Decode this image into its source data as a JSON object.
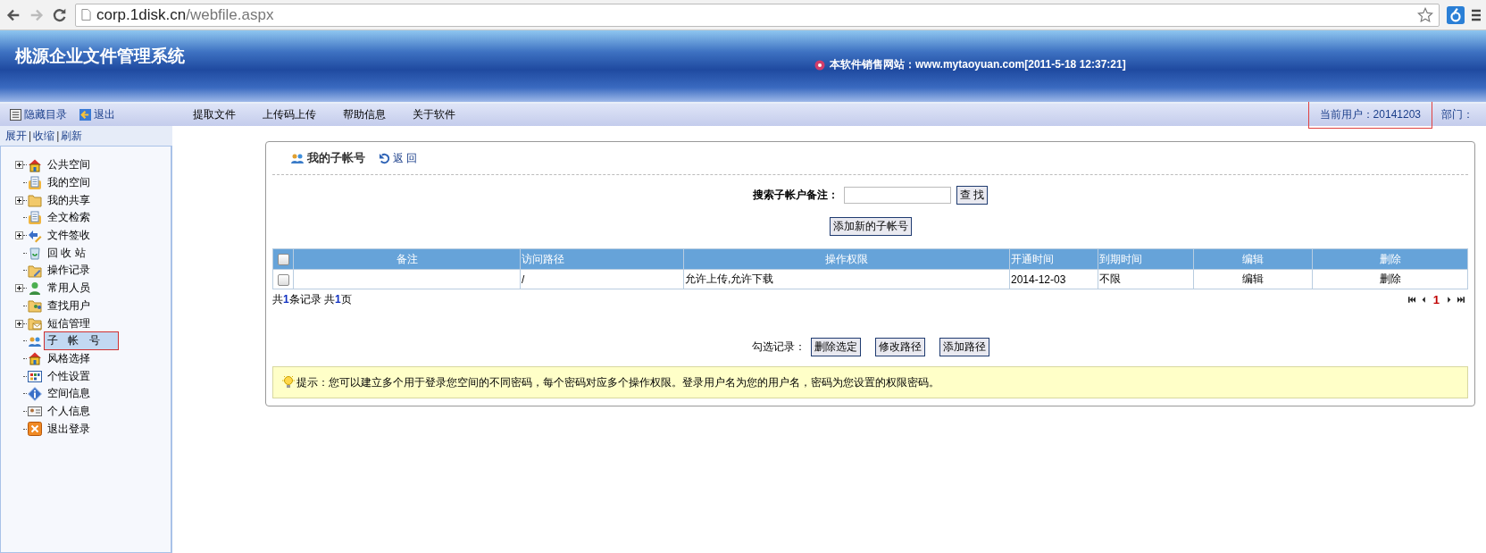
{
  "browser": {
    "url_host": "corp.1disk.cn",
    "url_path": "/webfile.aspx"
  },
  "header": {
    "title": "桃源企业文件管理系统",
    "site_info": "本软件销售网站：www.mytaoyuan.com[2011-5-18 12:37:21]"
  },
  "sidebar_actions": [
    "隐藏目录",
    "退出"
  ],
  "menu": [
    "提取文件",
    "上传码上传",
    "帮助信息",
    "关于软件"
  ],
  "user_info": {
    "current_user": "当前用户：20141203",
    "department": "部门："
  },
  "tree_links": [
    {
      "kind": "link",
      "text": "展开"
    },
    {
      "kind": "separator",
      "text": "|"
    },
    {
      "kind": "link",
      "text": "收缩"
    },
    {
      "kind": "separator",
      "text": "|"
    },
    {
      "kind": "link",
      "text": "刷新"
    }
  ],
  "tree": [
    {
      "label": "公共空间",
      "expanded": false,
      "selected": false
    },
    {
      "label": "我的空间",
      "selected": false
    },
    {
      "label": "我的共享",
      "expanded": false,
      "selected": false
    },
    {
      "label": "全文检索",
      "selected": false
    },
    {
      "label": "文件签收",
      "expanded": false,
      "selected": false
    },
    {
      "label": "回 收 站",
      "selected": false
    },
    {
      "label": "操作记录",
      "selected": false
    },
    {
      "label": "常用人员",
      "expanded": false,
      "selected": false
    },
    {
      "label": "查找用户",
      "selected": false
    },
    {
      "label": "短信管理",
      "expanded": false,
      "selected": false
    },
    {
      "label": "子 帐 号",
      "selected": true
    },
    {
      "label": "风格选择",
      "selected": false
    },
    {
      "label": "个性设置",
      "selected": false
    },
    {
      "label": "空间信息",
      "selected": false
    },
    {
      "label": "个人信息",
      "selected": false
    },
    {
      "label": "退出登录",
      "selected": false
    }
  ],
  "panel": {
    "title": "我的子帐号",
    "back": "返 回",
    "search_label": "搜索子帐户备注：",
    "search_button": "查 找",
    "add_button": "添加新的子帐号",
    "table": {
      "select_all_checked": false,
      "columns": [
        "备注",
        "访问路径",
        "操作权限",
        "开通时间",
        "到期时间",
        "编辑",
        "删除"
      ],
      "rows": [
        {
          "checked": false,
          "cells": [
            "",
            "/",
            "允许上传,允许下载",
            "2014-12-03",
            "不限",
            "编辑",
            "删除"
          ]
        }
      ]
    },
    "summary": "共**1**条记录 共**1**页",
    "current_page": "1",
    "bulk_label": "勾选记录：",
    "bulk_buttons": [
      "删除选定",
      "修改路径",
      "添加路径"
    ],
    "tip": "提示：您可以建立多个用于登录您空间的不同密码，每个密码对应多个操作权限。登录用户名为您的用户名，密码为您设置的权限密码。"
  }
}
